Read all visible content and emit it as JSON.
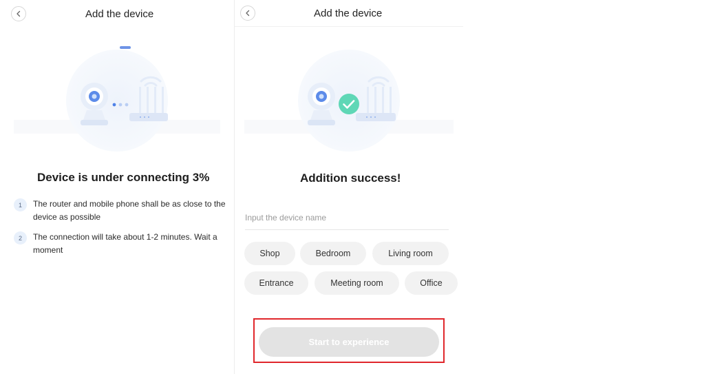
{
  "connecting_screen": {
    "title": "Add the device",
    "status": "Device is under connecting 3%",
    "progress_percent": 3,
    "tips": [
      {
        "num": "1",
        "text": "The router and mobile phone shall be as close to the device as possible"
      },
      {
        "num": "2",
        "text": "The connection will take about 1-2 minutes. Wait a moment"
      }
    ]
  },
  "success_screen": {
    "title": "Add the device",
    "status": "Addition success!",
    "name_input": {
      "placeholder": "Input the device name",
      "value": ""
    },
    "room_chips": [
      "Shop",
      "Bedroom",
      "Living room",
      "Entrance",
      "Meeting room",
      "Office"
    ],
    "cta_label": "Start to experience",
    "cta_enabled": false
  },
  "icons": {
    "back": "chevron-left-icon",
    "camera": "camera-icon",
    "router": "router-icon",
    "wifi": "wifi-icon",
    "success": "check-circle-icon"
  },
  "colors": {
    "success": "#5fd7b6",
    "highlight_frame": "#e0262b",
    "illustration_blue": "#4f82e8",
    "chip_bg": "#f2f2f2",
    "cta_disabled": "#e3e3e3"
  }
}
